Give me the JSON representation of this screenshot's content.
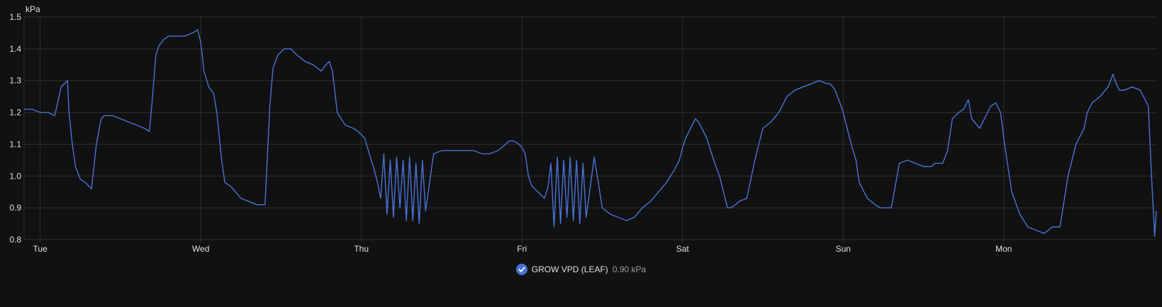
{
  "colors": {
    "background": "#111111",
    "grid": "#2f2f2f",
    "axis_text": "#e1e1e1",
    "series": "#4a72d6"
  },
  "legend": {
    "check_icon": "check-circle-icon",
    "name": "GROW VPD (LEAF)",
    "value": "0.90 kPa"
  },
  "chart_data": {
    "type": "line",
    "ylabel": "kPa",
    "ylim": [
      0.8,
      1.5
    ],
    "yticks": [
      "0.8",
      "0.9",
      "1.0",
      "1.1",
      "1.2",
      "1.3",
      "1.4",
      "1.5"
    ],
    "xlim": [
      0,
      7.05
    ],
    "xticks": [
      {
        "label": "Tue",
        "x": 0.1
      },
      {
        "label": "Wed",
        "x": 1.1
      },
      {
        "label": "Thu",
        "x": 2.1
      },
      {
        "label": "Fri",
        "x": 3.1
      },
      {
        "label": "Sat",
        "x": 4.1
      },
      {
        "label": "Sun",
        "x": 5.1
      },
      {
        "label": "Mon",
        "x": 6.1
      }
    ],
    "grid": true,
    "series": [
      {
        "name": "GROW VPD (LEAF)",
        "x": [
          0,
          0.05,
          0.1,
          0.15,
          0.19,
          0.2,
          0.23,
          0.25,
          0.27,
          0.28,
          0.3,
          0.32,
          0.35,
          0.38,
          0.4,
          0.42,
          0.45,
          0.48,
          0.5,
          0.52,
          0.55,
          0.6,
          0.65,
          0.7,
          0.75,
          0.78,
          0.8,
          0.82,
          0.84,
          0.87,
          0.9,
          0.95,
          1.0,
          1.05,
          1.08,
          1.1,
          1.12,
          1.15,
          1.18,
          1.2,
          1.23,
          1.25,
          1.28,
          1.3,
          1.35,
          1.4,
          1.45,
          1.5,
          1.53,
          1.55,
          1.58,
          1.62,
          1.66,
          1.7,
          1.75,
          1.8,
          1.85,
          1.88,
          1.9,
          1.92,
          1.95,
          2.0,
          2.05,
          2.08,
          2.1,
          2.12,
          2.15,
          2.18,
          2.2,
          2.22,
          2.24,
          2.26,
          2.28,
          2.3,
          2.32,
          2.34,
          2.36,
          2.38,
          2.4,
          2.42,
          2.44,
          2.46,
          2.48,
          2.5,
          2.55,
          2.6,
          2.7,
          2.8,
          2.85,
          2.9,
          2.95,
          3.0,
          3.02,
          3.05,
          3.08,
          3.1,
          3.12,
          3.14,
          3.16,
          3.18,
          3.2,
          3.22,
          3.24,
          3.26,
          3.28,
          3.3,
          3.32,
          3.34,
          3.36,
          3.38,
          3.4,
          3.42,
          3.44,
          3.46,
          3.48,
          3.5,
          3.55,
          3.6,
          3.65,
          3.7,
          3.75,
          3.8,
          3.85,
          3.9,
          3.95,
          4.0,
          4.05,
          4.08,
          4.1,
          4.12,
          4.15,
          4.18,
          4.2,
          4.25,
          4.3,
          4.33,
          4.35,
          4.38,
          4.4,
          4.43,
          4.45,
          4.5,
          4.55,
          4.6,
          4.65,
          4.7,
          4.75,
          4.8,
          4.85,
          4.9,
          4.95,
          5.0,
          5.02,
          5.05,
          5.08,
          5.1,
          5.12,
          5.15,
          5.18,
          5.2,
          5.25,
          5.3,
          5.33,
          5.35,
          5.37,
          5.4,
          5.45,
          5.5,
          5.55,
          5.6,
          5.65,
          5.67,
          5.7,
          5.72,
          5.75,
          5.78,
          5.8,
          5.82,
          5.85,
          5.88,
          5.9,
          5.95,
          6.0,
          6.02,
          6.05,
          6.08,
          6.1,
          6.12,
          6.15,
          6.2,
          6.25,
          6.3,
          6.35,
          6.38,
          6.4,
          6.43,
          6.45,
          6.5,
          6.55,
          6.6,
          6.62,
          6.65,
          6.7,
          6.75,
          6.78,
          6.8,
          6.82,
          6.85,
          6.9,
          6.95,
          7.0,
          7.02,
          7.04,
          7.05
        ],
        "values": [
          1.21,
          1.21,
          1.2,
          1.2,
          1.19,
          1.21,
          1.28,
          1.29,
          1.3,
          1.2,
          1.1,
          1.03,
          0.99,
          0.98,
          0.97,
          0.96,
          1.1,
          1.18,
          1.19,
          1.19,
          1.19,
          1.18,
          1.17,
          1.16,
          1.15,
          1.14,
          1.25,
          1.38,
          1.41,
          1.43,
          1.44,
          1.44,
          1.44,
          1.45,
          1.46,
          1.42,
          1.33,
          1.28,
          1.26,
          1.2,
          1.05,
          0.98,
          0.97,
          0.96,
          0.93,
          0.92,
          0.91,
          0.91,
          1.22,
          1.34,
          1.38,
          1.4,
          1.4,
          1.38,
          1.36,
          1.35,
          1.33,
          1.35,
          1.36,
          1.33,
          1.2,
          1.16,
          1.15,
          1.14,
          1.13,
          1.12,
          1.07,
          1.02,
          0.98,
          0.93,
          1.07,
          0.88,
          1.05,
          0.87,
          1.06,
          0.9,
          1.05,
          0.86,
          1.06,
          0.86,
          1.04,
          0.85,
          1.05,
          0.89,
          1.07,
          1.08,
          1.08,
          1.08,
          1.07,
          1.07,
          1.08,
          1.1,
          1.11,
          1.11,
          1.1,
          1.09,
          1.07,
          1.0,
          0.97,
          0.96,
          0.95,
          0.94,
          0.93,
          0.96,
          1.04,
          0.84,
          1.06,
          0.85,
          1.05,
          0.87,
          1.06,
          0.86,
          1.05,
          0.85,
          1.04,
          0.87,
          1.06,
          0.9,
          0.88,
          0.87,
          0.86,
          0.87,
          0.9,
          0.92,
          0.95,
          0.98,
          1.02,
          1.05,
          1.09,
          1.12,
          1.15,
          1.18,
          1.17,
          1.12,
          1.04,
          1.0,
          0.96,
          0.9,
          0.9,
          0.91,
          0.92,
          0.93,
          1.05,
          1.15,
          1.17,
          1.2,
          1.25,
          1.27,
          1.28,
          1.29,
          1.3,
          1.29,
          1.29,
          1.27,
          1.23,
          1.2,
          1.16,
          1.1,
          1.05,
          0.98,
          0.93,
          0.91,
          0.9,
          0.9,
          0.9,
          0.9,
          1.04,
          1.05,
          1.04,
          1.03,
          1.03,
          1.04,
          1.04,
          1.04,
          1.08,
          1.18,
          1.19,
          1.2,
          1.21,
          1.24,
          1.18,
          1.15,
          1.2,
          1.22,
          1.23,
          1.2,
          1.12,
          1.05,
          0.95,
          0.88,
          0.84,
          0.83,
          0.82,
          0.83,
          0.84,
          0.84,
          0.84,
          1.0,
          1.1,
          1.15,
          1.2,
          1.23,
          1.25,
          1.28,
          1.32,
          1.29,
          1.27,
          1.27,
          1.28,
          1.27,
          1.22,
          1.0,
          0.81,
          0.89
        ]
      }
    ]
  }
}
